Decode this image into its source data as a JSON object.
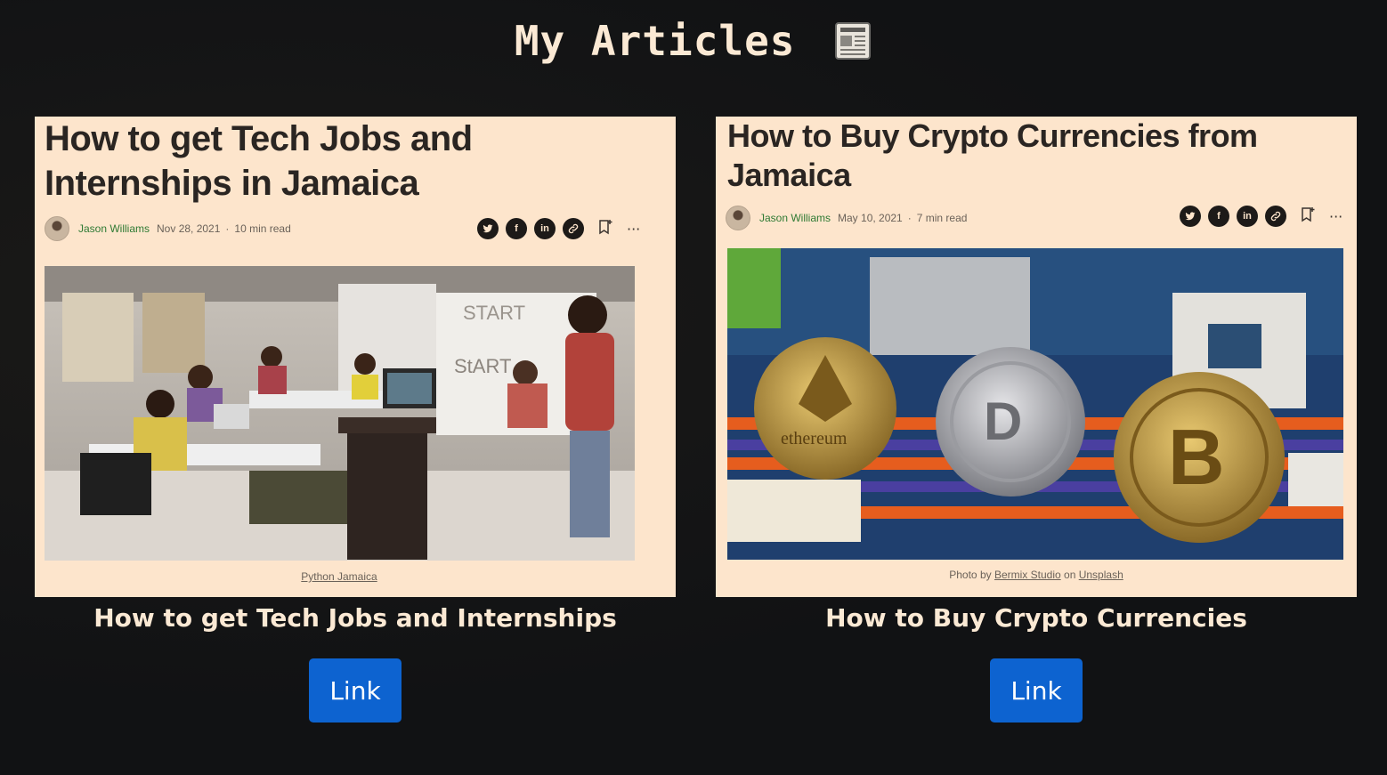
{
  "page": {
    "title": "My Articles",
    "title_icon": "newspaper-icon"
  },
  "articles": [
    {
      "preview_title": "How to get Tech Jobs and Internships in Jamaica",
      "author": "Jason Williams",
      "date": "Nov 28, 2021",
      "read_time": "10 min read",
      "caption": "Python Jamaica",
      "card_title": "How to get Tech Jobs and Internships",
      "button_label": "Link"
    },
    {
      "preview_title": "How to Buy Crypto Currencies from Jamaica",
      "author": "Jason Williams",
      "date": "May 10, 2021",
      "read_time": "7 min read",
      "caption_prefix": "Photo by",
      "caption_link1": "Bermix Studio",
      "caption_mid": "on",
      "caption_link2": "Unsplash",
      "card_title": "How to Buy Crypto Currencies",
      "button_label": "Link"
    }
  ],
  "share_icons": [
    "twitter-icon",
    "facebook-icon",
    "linkedin-icon",
    "link-icon",
    "bookmark-icon",
    "more-icon"
  ],
  "share_glyphs": {
    "facebook": "f",
    "linkedin": "in",
    "more": "···"
  },
  "colors": {
    "background": "#111214",
    "card": "#fde5cc",
    "button": "#0d63d0",
    "heading": "#fbe9d4",
    "author": "#2f7a34"
  }
}
